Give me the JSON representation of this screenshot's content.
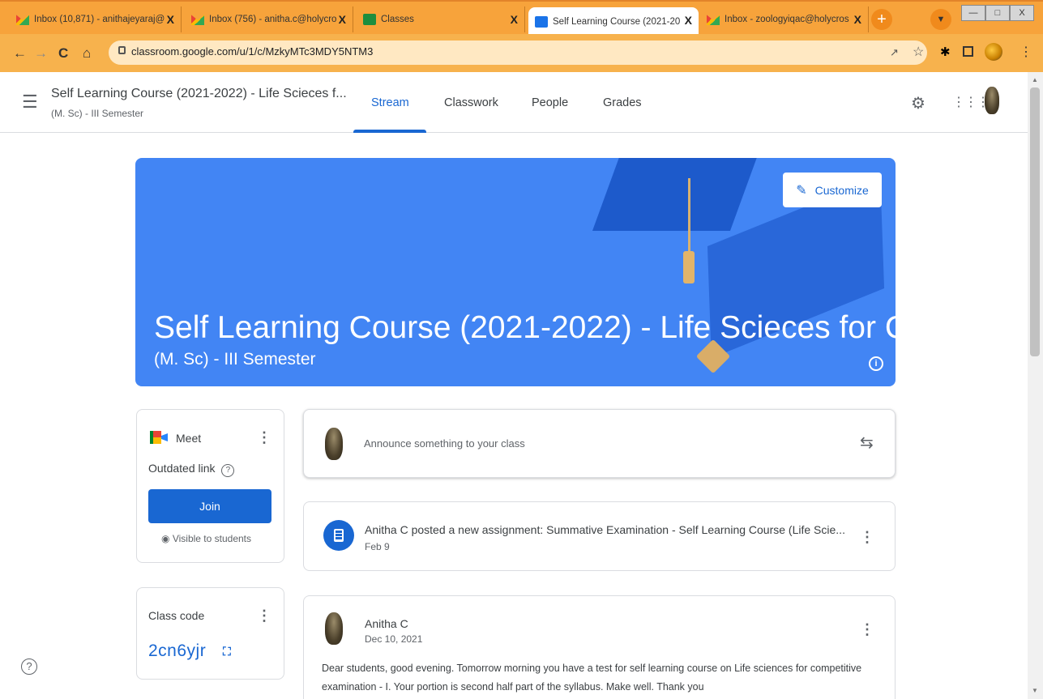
{
  "browser": {
    "tabs": [
      {
        "label": "Inbox (10,871) - anithajeyaraj@",
        "icon": "gmail-icon"
      },
      {
        "label": "Inbox (756) - anitha.c@holycro",
        "icon": "gmail-icon"
      },
      {
        "label": "Classes",
        "icon": "classroom-icon"
      },
      {
        "label": "Self Learning Course (2021-20",
        "icon": "classroom-icon",
        "active": true
      },
      {
        "label": "Inbox - zoologyiqac@holycros",
        "icon": "gmail-icon"
      }
    ],
    "close_glyph": "X",
    "new_tab_glyph": "+",
    "url": "classroom.google.com/u/1/c/MzkyMTc3MDY5NTM3"
  },
  "appbar": {
    "class_title": "Self Learning Course (2021-2022) - Life Scieces f...",
    "class_subtitle": "(M. Sc) - III Semester",
    "tabs": [
      "Stream",
      "Classwork",
      "People",
      "Grades"
    ],
    "active_tab": "Stream"
  },
  "banner": {
    "title": "Self Learning Course (2021-2022) - Life Scieces for C...",
    "subtitle": "(M. Sc) - III Semester",
    "customize_label": "Customize",
    "color": "#4285f4"
  },
  "meet": {
    "title": "Meet",
    "status": "Outdated link",
    "join_label": "Join",
    "visibility": "Visible to students"
  },
  "class_code": {
    "label": "Class code",
    "code": "2cn6yjr"
  },
  "stream": {
    "announce_placeholder": "Announce something to your class",
    "assignment": {
      "title": "Anitha C posted a new assignment: Summative Examination - Self Learning Course (Life Scie...",
      "date": "Feb 9"
    },
    "post": {
      "author": "Anitha C",
      "date": "Dec 10, 2021",
      "body": "Dear students, good evening. Tomorrow morning you have a test for self learning course on Life sciences for competitive examination - I. Your portion is second half part of the syllabus. Make well. Thank you"
    }
  },
  "colors": {
    "accent": "#1967d2",
    "tabbar": "#f7a33b",
    "addrbar": "#f7b24d"
  }
}
